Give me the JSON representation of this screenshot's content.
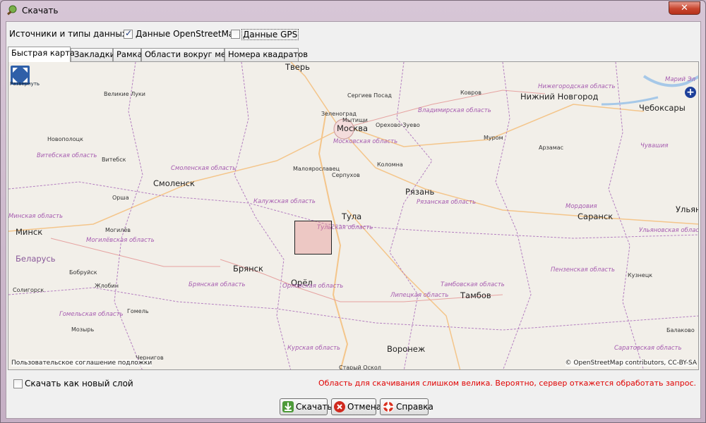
{
  "window": {
    "title": "Скачать",
    "close_label": "✕"
  },
  "sources": {
    "label": "Источники и типы данных:",
    "osm_label": "Данные OpenStreetMap",
    "osm_checked": true,
    "gps_label": "Данные GPS",
    "gps_checked": false
  },
  "tabs": [
    {
      "label": "Быстрая карта",
      "active": true
    },
    {
      "label": "Закладки"
    },
    {
      "label": "Рамка"
    },
    {
      "label": "Области вокруг мест"
    },
    {
      "label": "Номера квадратов"
    }
  ],
  "map": {
    "fullscreen_label": "Развернуть",
    "attribution_left": "Пользовательское соглашение подложки",
    "attribution_right": "© OpenStreetMap contributors, CC-BY-SA",
    "cities_big": [
      "Тверь",
      "Москва",
      "Нижний Новгород",
      "Чебоксары",
      "Смоленск",
      "Рязань",
      "Тула",
      "Саранск",
      "Минск",
      "Брянск",
      "Орёл",
      "Тамбов",
      "Воронеж",
      "Ульяновск",
      "Беларусь"
    ],
    "cities_small": [
      "Великие Луки",
      "Сергиев Посад",
      "Ковров",
      "Зеленоград",
      "Мытищи",
      "Орехово-Зуево",
      "Новополоцк",
      "Витебск",
      "Муром",
      "Арзамас",
      "Малоярославец",
      "Коломна",
      "Серпухов",
      "Орша",
      "Могилёв",
      "Бобруйск",
      "Жлобин",
      "Солигорск",
      "Гомель",
      "Мозырь",
      "Кузнецк",
      "Балаково",
      "Чернигов",
      "Старый Оскол",
      "Марий Эл"
    ],
    "regions": [
      "Нижегородская область",
      "Владимирская область",
      "Витебская область",
      "Смоленская область",
      "Московская область",
      "Калужская область",
      "Рязанская область",
      "Чувашия",
      "Мордовия",
      "Минская область",
      "Могилёвская область",
      "Тульская область",
      "Ульяновская область",
      "Брянская область",
      "Орловская область",
      "Пензенская область",
      "Тамбовская область",
      "Липецкая область",
      "Гомельская область",
      "Курская область",
      "Саратовская область"
    ]
  },
  "options": {
    "new_layer_label": "Скачать как новый слой",
    "new_layer_checked": false
  },
  "warning": "Область для скачивания слишком велика. Вероятно, сервер откажется обработать запрос.",
  "buttons": {
    "download": "Скачать",
    "cancel": "Отмена",
    "help": "Справка"
  }
}
